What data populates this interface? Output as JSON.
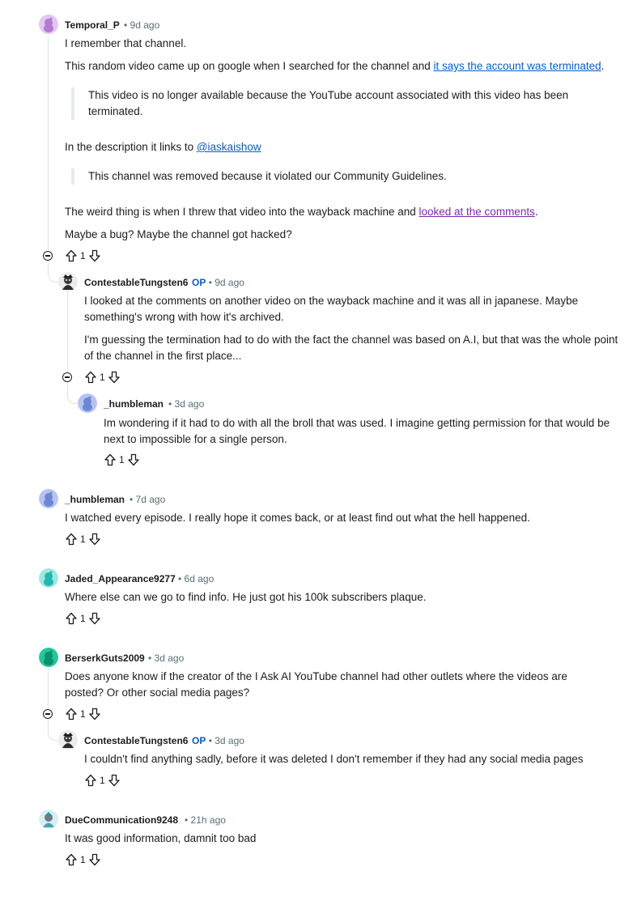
{
  "comments": [
    {
      "user": "Temporal_P",
      "time": "9d ago",
      "op": "",
      "avatar_color": "#d7a8e8",
      "p1": "I remember that channel.",
      "p2_text": "This random video came up on google when I searched for the channel and ",
      "p2_link": "it says the account was terminated",
      "p2_end": ".",
      "quote1": "This video is no longer available because the YouTube account associated with this video has been terminated.",
      "p3_text": "In the description it links to ",
      "p3_link": "@iaskaishow",
      "quote2": "This channel was removed because it violated our Community Guidelines.",
      "p4_text": "The weird thing is when I threw that video into the wayback machine and ",
      "p4_link": "looked at the comments",
      "p4_end": ".",
      "p5": "Maybe a bug? Maybe the channel got hacked?",
      "votes": "1"
    },
    {
      "user": "ContestableTungsten6",
      "time": "9d ago",
      "op": "OP",
      "avatar_color": "#2b2b2b",
      "p1": "I looked at the comments on another video on the wayback machine and it was all in japanese. Maybe something's wrong with how it's archived.",
      "p2": "I'm guessing the termination had to do with the fact the channel was based on A.I, but that was the whole point of the channel in the first place...",
      "votes": "1"
    },
    {
      "user": "_humbleman",
      "time": "3d ago",
      "op": "",
      "avatar_color": "#8aa1e6",
      "p1": "Im wondering if it had to do with all the broll that was used. I imagine getting permission for that would be next to impossible for a single person.",
      "votes": "1"
    },
    {
      "user": "_humbleman",
      "time": "7d ago",
      "op": "",
      "avatar_color": "#8aa1e6",
      "p1": "I watched every episode. I really hope it comes back, or at least find out what the hell happened.",
      "votes": "1"
    },
    {
      "user": "Jaded_Appearance9277",
      "time": "6d ago",
      "op": "",
      "avatar_color": "#3fd1c6",
      "p1": "Where else can we go to find info. He just got his 100k subscribers plaque.",
      "votes": "1"
    },
    {
      "user": "BerserkGuts2009",
      "time": "3d ago",
      "op": "",
      "avatar_color": "#22c79a",
      "p1": "Does anyone know if the creator of the I Ask AI YouTube channel had other outlets where the videos are posted? Or other social media pages?",
      "votes": "1"
    },
    {
      "user": "ContestableTungsten6",
      "time": "3d ago",
      "op": "OP",
      "avatar_color": "#2b2b2b",
      "p1": "I couldn't find anything sadly, before it was deleted I don't remember if they had any social media pages",
      "votes": "1"
    },
    {
      "user": "DueCommunication9248",
      "time": "21h ago",
      "op": "",
      "avatar_color": "#4aa3b0",
      "p1": "It was good information, damnit too bad",
      "votes": "1"
    }
  ],
  "sep": "•",
  "icons": {
    "upvote": "upvote-icon",
    "downvote": "downvote-icon",
    "collapse": "collapse-icon",
    "avatar": "snoo-avatar-icon"
  },
  "colors": {
    "link": "#0a5dc2",
    "visited_link": "#7b2bab",
    "meta": "#576f76",
    "thread_line": "#dfe3e6"
  }
}
